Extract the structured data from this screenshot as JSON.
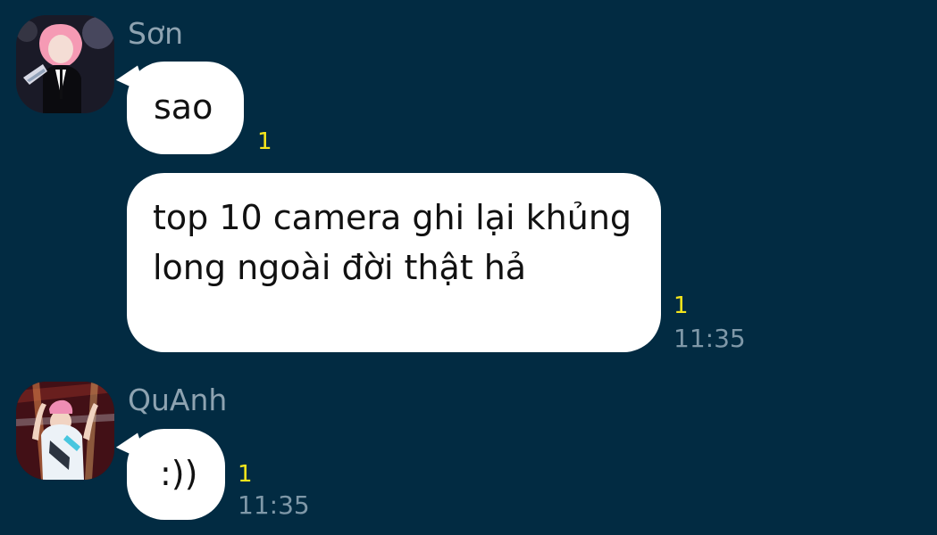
{
  "messages": [
    {
      "sender": "Sơn",
      "text": "sao",
      "unread": "1",
      "time": ""
    },
    {
      "sender": "",
      "text": "top 10 camera ghi lại khủng long ngoài đời thật hả",
      "unread": "1",
      "time": "11:35"
    },
    {
      "sender": "QuAnh",
      "text": ":))",
      "unread": "1",
      "time": "11:35"
    }
  ]
}
